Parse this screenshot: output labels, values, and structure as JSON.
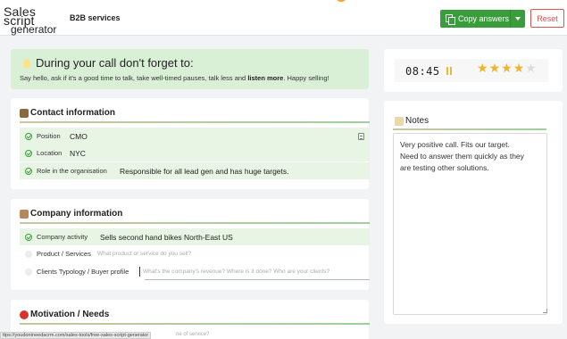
{
  "header": {
    "logo_line1": "Sales script",
    "logo_line2": "generator",
    "subtitle": "B2B services",
    "copy_button": "Copy answers",
    "reset_button": "Reset"
  },
  "tip": {
    "title": "During your call don't forget to:",
    "text_before": "Say hello, ask if it's a good time to talk, take well-timed pauses, talk less and ",
    "text_bold": "listen more",
    "text_after": ". Happy selling!"
  },
  "contact": {
    "title": "Contact information",
    "rows": [
      {
        "label": "Position",
        "value": "CMO"
      },
      {
        "label": "Location",
        "value": "NYC"
      },
      {
        "label": "Role in the organisation",
        "value": "Responsible for all lead gen and has huge targets."
      }
    ]
  },
  "company": {
    "title": "Company information",
    "rows": [
      {
        "label": "Company activity",
        "value": "Sells second hand bikes North-East US"
      },
      {
        "label": "Product / Services",
        "placeholder": "What product or service do you sell?"
      },
      {
        "label": "Clients Typology / Buyer profile",
        "placeholder": "What's the company's revenue? Where is it done? Who are your clients?"
      }
    ]
  },
  "motivation": {
    "title": "Motivation / Needs"
  },
  "timer": {
    "display": "08:45",
    "rating": 4,
    "max_rating": 5
  },
  "notes": {
    "title": "Notes",
    "text": "Very positive call. Fits our target.\nNeed to answer them quickly as they\nare testing other solutions."
  },
  "status_bar": {
    "url": "ttps://youdontneedacrm.com/sales-tools/free-sales-script-generator",
    "partial_text": "ne of service?"
  },
  "colors": {
    "brand_green": "#3a9d3c",
    "reset_red": "#d9534f",
    "star_gold": "#f1b32b",
    "tip_background": "#d9f0d6"
  }
}
